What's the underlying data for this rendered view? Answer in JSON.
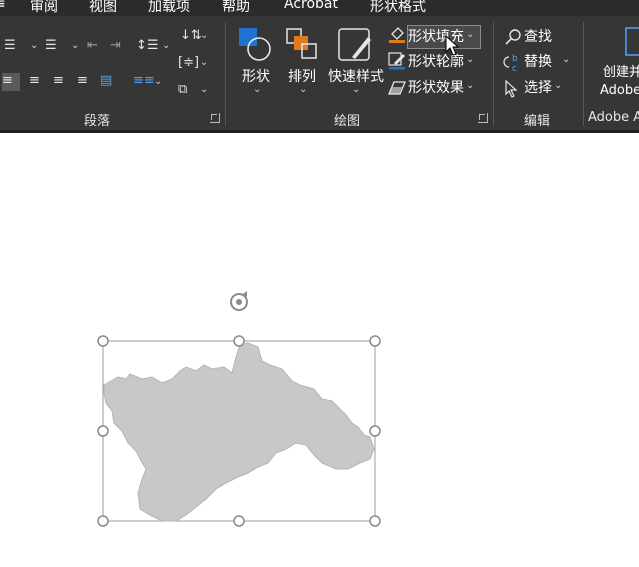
{
  "tabs": [
    "审阅",
    "视图",
    "加载项",
    "帮助",
    "Acrobat",
    "形状格式"
  ],
  "groups": {
    "paragraph": "段落",
    "drawing": "绘图",
    "editing": "编辑",
    "adobe": "Adobe A"
  },
  "drawing": {
    "shape_label": "形状",
    "arrange_label": "排列",
    "quick_styles_label": "快速样式",
    "shape_fill": "形状填充",
    "shape_outline": "形状轮廓",
    "shape_effects": "形状效果"
  },
  "editing": {
    "find": "查找",
    "replace": "替换",
    "select": "选择"
  },
  "adobe": {
    "create_line1": "创建并",
    "create_line2": "Adobe"
  },
  "colors": {
    "ribbon_bg": "#363636",
    "accent_orange": "#e07a1f",
    "accent_blue": "#1e73d2",
    "selection_shape_fill": "#c8c8c8"
  }
}
